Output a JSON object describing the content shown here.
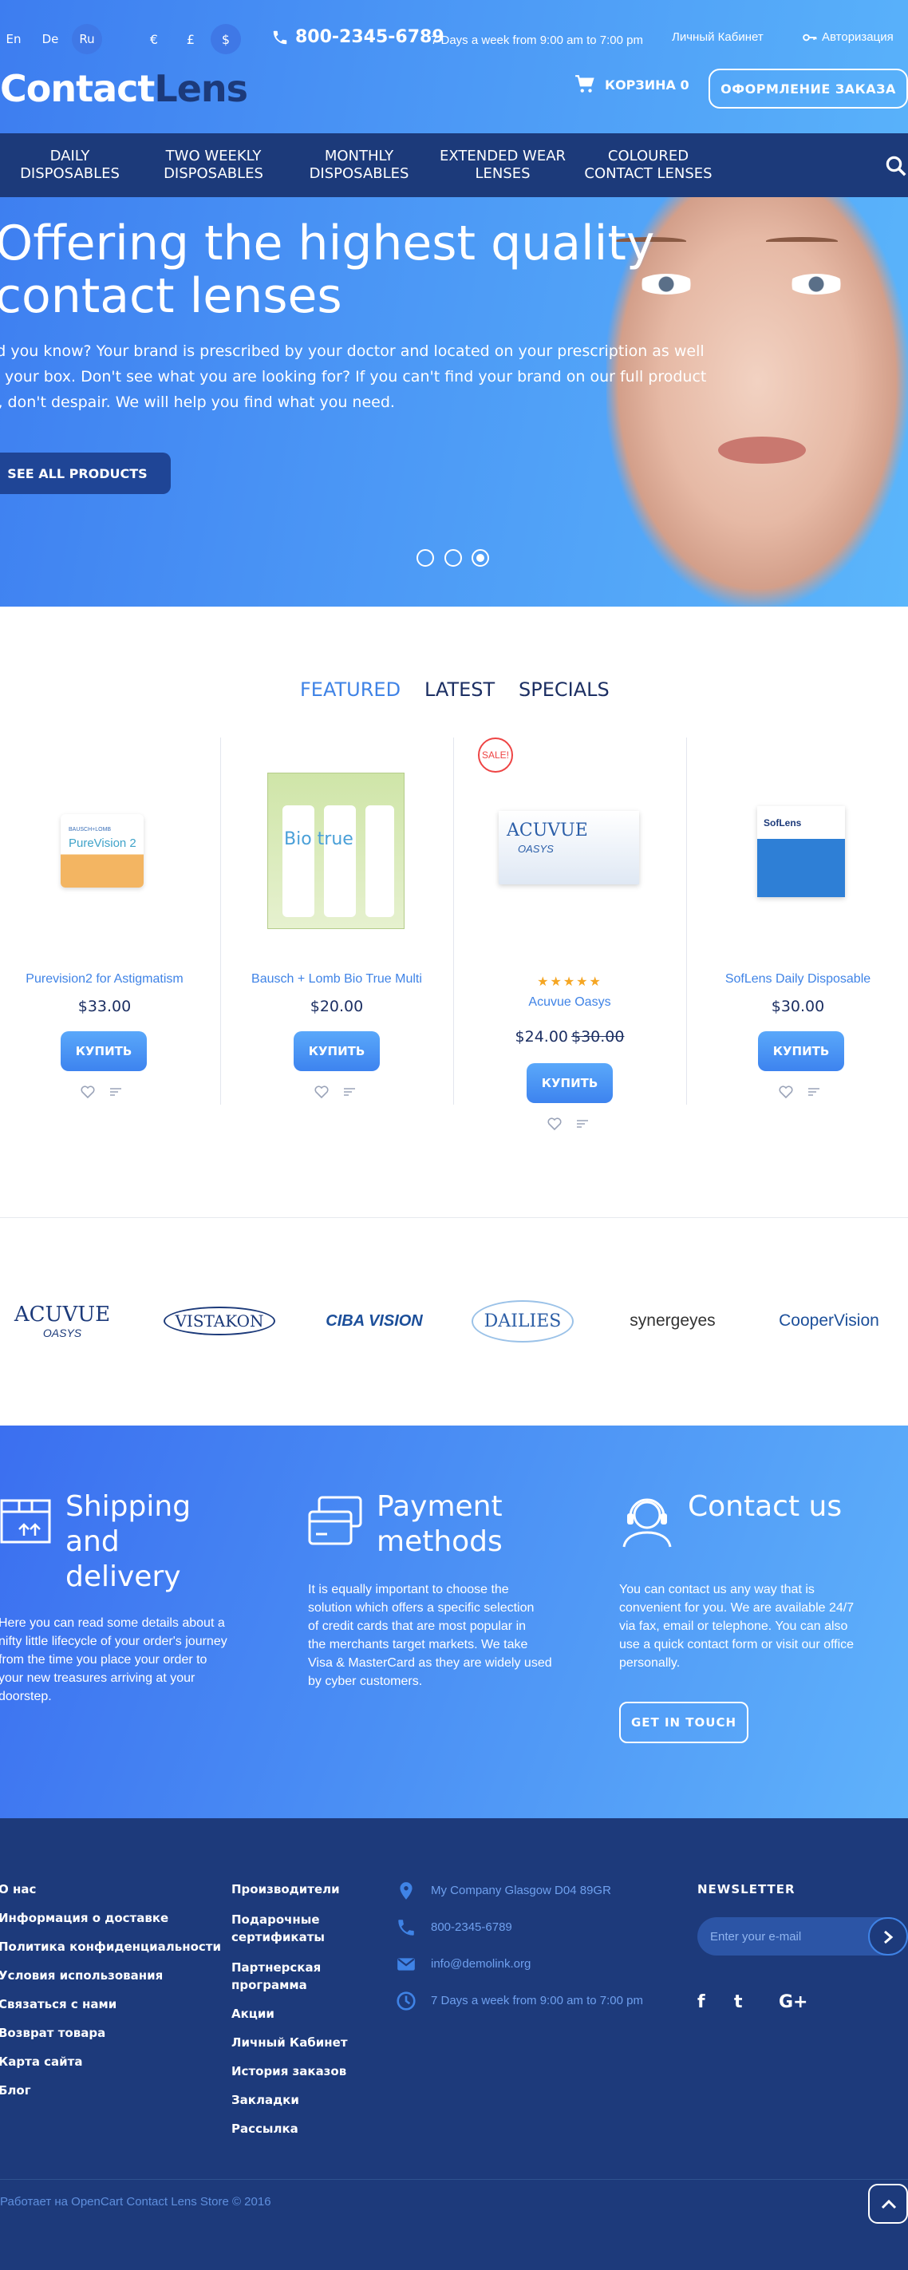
{
  "header": {
    "languages": [
      "En",
      "De",
      "Ru"
    ],
    "active_language": "Ru",
    "currencies": [
      "€",
      "£",
      "$"
    ],
    "active_currency": "$",
    "phone": "800-2345-6789",
    "hours": "7 Days a week from 9:00 am to 7:00 pm",
    "account": "Личный Кабинет",
    "login": "Авторизация",
    "logo_part1": "Contact",
    "logo_part2": "Lens",
    "cart": "КОРЗИНА 0",
    "checkout": "ОФОРМЛЕНИЕ ЗАКАЗА"
  },
  "nav": {
    "items": [
      {
        "line1": "DAILY",
        "line2": "DISPOSABLES"
      },
      {
        "line1": "TWO WEEKLY",
        "line2": "DISPOSABLES"
      },
      {
        "line1": "MONTHLY",
        "line2": "DISPOSABLES"
      },
      {
        "line1": "EXTENDED WEAR",
        "line2": "LENSES"
      },
      {
        "line1": "COLOURED",
        "line2": "CONTACT LENSES"
      }
    ]
  },
  "slider": {
    "title_line1": "Offering the highest quality",
    "title_line2": "contact lenses",
    "text_line1": "id you know? Your brand is prescribed by your doctor and located on your prescription as well",
    "text_line2": "s your box. Don't see what you are looking for? If you can't find your brand on our full product",
    "text_line3": "t, don't despair. We will help you find what you need.",
    "button": "SEE ALL PRODUCTS",
    "active_slide": 3,
    "slide_count": 3
  },
  "product_tabs": {
    "items": [
      "FEATURED",
      "LATEST",
      "SPECIALS"
    ],
    "active": "FEATURED"
  },
  "products": [
    {
      "name": "Purevision2 for Astigmatism",
      "price": "$33.00",
      "old_price": "",
      "buy": "КУПИТЬ",
      "sale": "",
      "rating": ""
    },
    {
      "name": "Bausch + Lomb Bio True Multi",
      "price": "$20.00",
      "old_price": "",
      "buy": "КУПИТЬ",
      "sale": "",
      "rating": ""
    },
    {
      "name": "Acuvue Oasys",
      "price": "$24.00",
      "old_price": "$30.00",
      "buy": "КУПИТЬ",
      "sale": "SALE!",
      "rating": "★★★★★"
    },
    {
      "name": "SofLens Daily Disposable",
      "price": "$30.00",
      "old_price": "",
      "buy": "КУПИТЬ",
      "sale": "",
      "rating": ""
    }
  ],
  "product_image_text": {
    "purevision": "PureVision 2",
    "purevision_brand": "BAUSCH+LOMB",
    "biotrue": "Bio true",
    "acuvue": "ACUVUE",
    "acuvue_sub": "OASYS",
    "soflens": "SofLens"
  },
  "brands": [
    {
      "name": "ACUVUE",
      "sub": "OASYS"
    },
    {
      "name": "VISTAKON",
      "sub": ""
    },
    {
      "name": "CIBA VISION",
      "sub": ""
    },
    {
      "name": "DAILIES",
      "sub": ""
    },
    {
      "name": "synergeyes",
      "sub": ""
    },
    {
      "name": "CooperVision",
      "sub": ""
    }
  ],
  "info": {
    "shipping": {
      "title_lines": [
        "Shipping",
        "and",
        "delivery"
      ],
      "text_lines": [
        "Here you can read some details about a",
        "nifty little lifecycle of your order's journey",
        "from the time you place your order to",
        "your new treasures arriving at your",
        "doorstep."
      ]
    },
    "payment": {
      "title_lines": [
        "Payment",
        "methods"
      ],
      "text_lines": [
        "It is equally important to choose the",
        "solution which offers a specific selection",
        "of credit cards that are most popular in",
        "the merchants target markets. We take",
        "Visa & MasterCard as they are widely used",
        "by cyber customers."
      ]
    },
    "contact": {
      "title_lines": [
        "Contact us"
      ],
      "text_lines": [
        "You can contact us any way that is",
        "convenient for you. We are available 24/7",
        "via fax, email or telephone. You can also",
        "use a quick contact form or visit our office",
        "personally."
      ],
      "button": "GET IN TOUCH"
    }
  },
  "footer": {
    "col1": [
      "О нас",
      "Информация о доставке",
      "Политика конфиденциальности",
      "Условия использования",
      "Связаться с нами",
      "Возврат товара",
      "Карта сайта",
      "Блог"
    ],
    "col2": [
      "Производители",
      "Подарочные сертификаты",
      "Партнерская программа",
      "Акции",
      "Личный Кабинет",
      "История заказов",
      "Закладки",
      "Рассылка"
    ],
    "address": "My Company Glasgow D04 89GR",
    "phone": "800-2345-6789",
    "email": "info@demolink.org",
    "hours": "7 Days a week from 9:00 am to 7:00 pm",
    "newsletter_title": "NEWSLETTER",
    "newsletter_placeholder": "Enter your e-mail",
    "social": [
      "f",
      "t",
      "G+"
    ],
    "powered": "Работает на OpenCart Contact Lens Store © 2016"
  },
  "colors": {
    "accent": "#3f83e6",
    "navy": "#1c3a7a",
    "sale": "#e44444",
    "star": "#f5a623"
  }
}
